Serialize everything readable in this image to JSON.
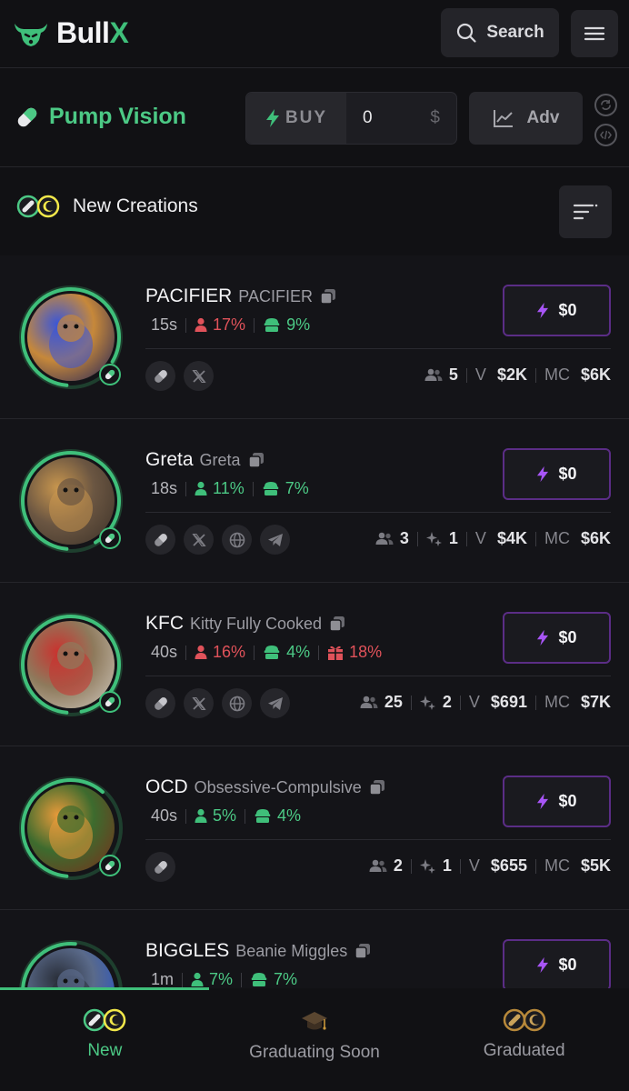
{
  "header": {
    "logo_text": "Bull",
    "logo_accent": "X",
    "search_label": "Search"
  },
  "pump_vision": {
    "title": "Pump Vision",
    "buy_label": "BUY",
    "buy_amount": "0",
    "currency_symbol": "$",
    "adv_label": "Adv"
  },
  "section": {
    "title": "New Creations"
  },
  "tokens": [
    {
      "ticker": "PACIFIER",
      "name": "PACIFIER",
      "age": "15s",
      "stats": [
        {
          "kind": "holders",
          "value": "17%",
          "tone": "red"
        },
        {
          "kind": "dev",
          "value": "9%",
          "tone": "green"
        }
      ],
      "socials": [
        "pill",
        "x"
      ],
      "holders": "5",
      "snipers": "",
      "volume": "$2K",
      "mcap": "$6K",
      "buy_label": "$0",
      "avatar_colors": [
        "#1c1f5a",
        "#3a56d8",
        "#c6883a"
      ],
      "arc": 0.82
    },
    {
      "ticker": "Greta",
      "name": "Greta",
      "age": "18s",
      "stats": [
        {
          "kind": "holders",
          "value": "11%",
          "tone": "green"
        },
        {
          "kind": "dev",
          "value": "7%",
          "tone": "green"
        }
      ],
      "socials": [
        "pill",
        "x",
        "globe",
        "telegram"
      ],
      "holders": "3",
      "snipers": "1",
      "volume": "$4K",
      "mcap": "$6K",
      "buy_label": "$0",
      "avatar_colors": [
        "#3b3128",
        "#c8964e",
        "#6b5642"
      ],
      "arc": 0.9
    },
    {
      "ticker": "KFC",
      "name": "Kitty Fully Cooked",
      "age": "40s",
      "stats": [
        {
          "kind": "holders",
          "value": "16%",
          "tone": "red"
        },
        {
          "kind": "dev",
          "value": "4%",
          "tone": "green"
        },
        {
          "kind": "bundle",
          "value": "18%",
          "tone": "red"
        }
      ],
      "socials": [
        "pill",
        "x",
        "globe",
        "telegram"
      ],
      "holders": "25",
      "snipers": "2",
      "volume": "$691",
      "mcap": "$7K",
      "buy_label": "$0",
      "avatar_colors": [
        "#cfc7bd",
        "#c9332f",
        "#8e7a5c"
      ],
      "arc": 0.95
    },
    {
      "ticker": "OCD",
      "name": "Obsessive-Compulsive",
      "age": "40s",
      "stats": [
        {
          "kind": "holders",
          "value": "5%",
          "tone": "green"
        },
        {
          "kind": "dev",
          "value": "4%",
          "tone": "green"
        }
      ],
      "socials": [
        "pill"
      ],
      "holders": "2",
      "snipers": "1",
      "volume": "$655",
      "mcap": "$5K",
      "buy_label": "$0",
      "avatar_colors": [
        "#7a2d1a",
        "#e89a3a",
        "#3d6b2e"
      ],
      "arc": 0.6
    },
    {
      "ticker": "BIGGLES",
      "name": "Beanie Miggles",
      "age": "1m",
      "stats": [
        {
          "kind": "holders",
          "value": "7%",
          "tone": "green"
        },
        {
          "kind": "dev",
          "value": "7%",
          "tone": "green"
        }
      ],
      "socials": [
        "pill"
      ],
      "holders": "",
      "snipers": "",
      "volume": "",
      "mcap": "",
      "buy_label": "$0",
      "avatar_colors": [
        "#1a4fd6",
        "#2a2f3a",
        "#5a6a8a"
      ],
      "arc": 0.5
    }
  ],
  "labels": {
    "volume_prefix": "V",
    "mcap_prefix": "MC"
  },
  "bottom_nav": [
    {
      "label": "New",
      "active": true,
      "icon": "eyes-icon"
    },
    {
      "label": "Graduating Soon",
      "active": false,
      "icon": "grad-cap-icon"
    },
    {
      "label": "Graduated",
      "active": false,
      "icon": "eyes-gold-icon"
    }
  ],
  "colors": {
    "accent_green": "#3fbf7a",
    "accent_purple": "#a855f7",
    "negative_red": "#e0525a"
  }
}
